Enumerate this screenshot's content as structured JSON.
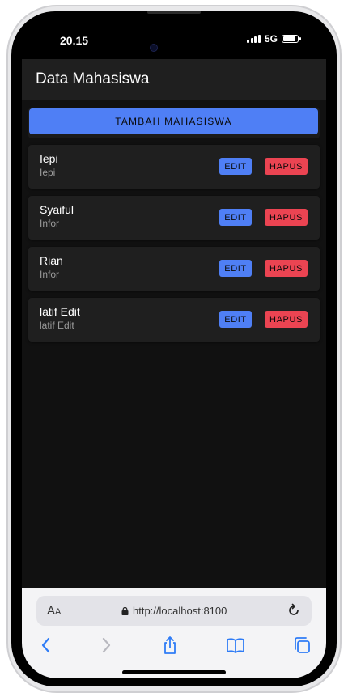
{
  "status_bar": {
    "time": "20.15",
    "network": "5G",
    "battery_level": 0.9
  },
  "header": {
    "title": "Data Mahasiswa"
  },
  "actions": {
    "add_label": "TAMBAH MAHASISWA"
  },
  "students": [
    {
      "name": "Iepi",
      "major": "Iepi",
      "edit_label": "EDIT",
      "delete_label": "HAPUS"
    },
    {
      "name": "Syaiful",
      "major": "Infor",
      "edit_label": "EDIT",
      "delete_label": "HAPUS"
    },
    {
      "name": "Rian",
      "major": "Infor",
      "edit_label": "EDIT",
      "delete_label": "HAPUS"
    },
    {
      "name": "latif Edit",
      "major": "latif Edit",
      "edit_label": "EDIT",
      "delete_label": "HAPUS"
    }
  ],
  "browser": {
    "text_size_label": "A",
    "text_size_label_small": "A",
    "url": "http://localhost:8100"
  },
  "colors": {
    "primary": "#4f7ff5",
    "danger": "#eb4452",
    "card": "#1f1f1f",
    "background": "#111111"
  }
}
